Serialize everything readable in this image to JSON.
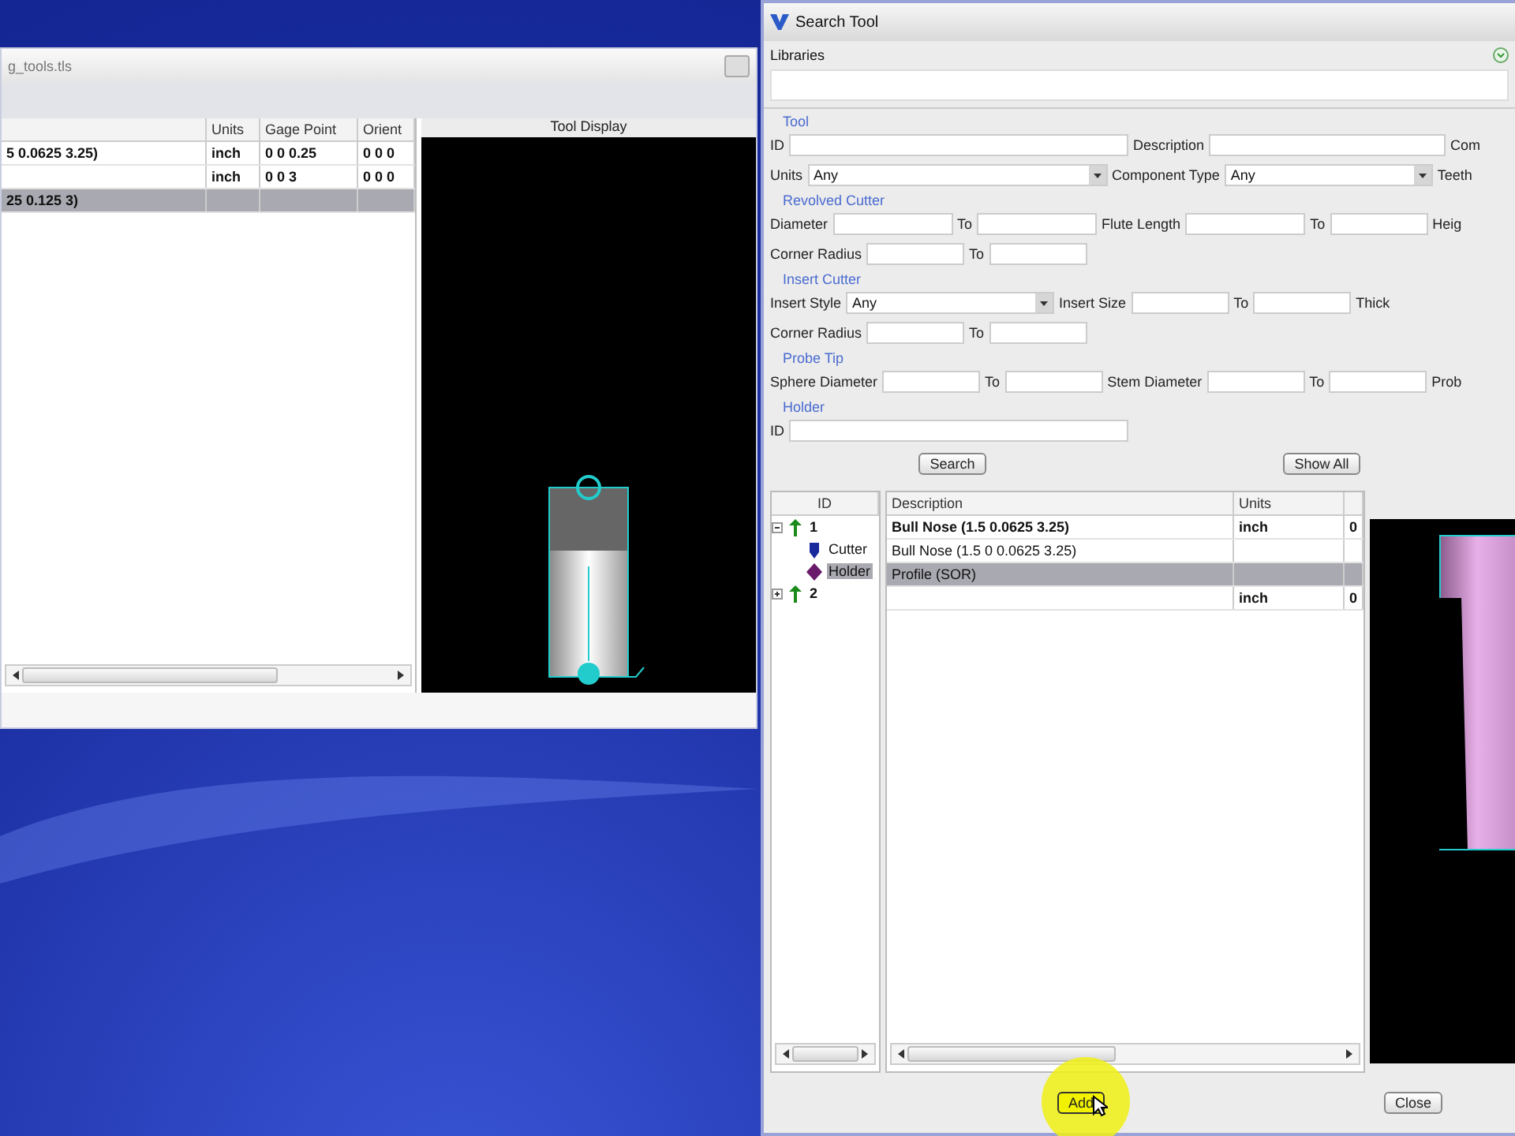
{
  "library_window": {
    "title": "g_tools.tls",
    "table": {
      "columns": [
        "Units",
        "Gage Point",
        "Orient"
      ],
      "rows": [
        {
          "description": "5 0.0625 3.25)",
          "units": "inch",
          "gage_point": "0 0 0.25",
          "orient": "0 0 0",
          "selected": false
        },
        {
          "units": "inch",
          "gage_point": "0 0 3",
          "orient": "0 0 0",
          "selected": false
        },
        {
          "description": "25 0.125 3)",
          "selected": true
        }
      ]
    },
    "tool_display": {
      "title": "Tool Display"
    }
  },
  "search_tool": {
    "title": "Search Tool",
    "libraries": {
      "label": "Libraries",
      "expanded": false
    },
    "groups": [
      {
        "title": "Tool",
        "rows": [
          [
            {
              "kind": "label",
              "text": "ID"
            },
            {
              "kind": "long-field"
            },
            {
              "kind": "label",
              "text": "Description"
            },
            {
              "kind": "medium-field"
            },
            {
              "kind": "label",
              "text": "Com"
            }
          ],
          [
            {
              "kind": "label",
              "text": "Units"
            },
            {
              "kind": "long-select",
              "value": "Any"
            },
            {
              "kind": "label",
              "text": "Component Type"
            },
            {
              "kind": "select",
              "value": "Any"
            },
            {
              "kind": "label",
              "text": "Teeth"
            }
          ]
        ]
      },
      {
        "title": "Revolved Cutter",
        "rows": [
          [
            {
              "kind": "label",
              "text": "Diameter"
            },
            {
              "kind": "field"
            },
            {
              "kind": "label",
              "text": "To"
            },
            {
              "kind": "field"
            },
            {
              "kind": "label",
              "text": "Flute Length"
            },
            {
              "kind": "field"
            },
            {
              "kind": "label",
              "text": "To"
            },
            {
              "kind": "short-field"
            },
            {
              "kind": "label",
              "text": "Heig"
            }
          ],
          [
            {
              "kind": "label",
              "text": "Corner Radius"
            },
            {
              "kind": "short-field"
            },
            {
              "kind": "label",
              "text": "To"
            },
            {
              "kind": "short-field"
            }
          ]
        ]
      },
      {
        "title": "Insert Cutter",
        "rows": [
          [
            {
              "kind": "label",
              "text": "Insert Style"
            },
            {
              "kind": "select",
              "value": "Any"
            },
            {
              "kind": "label",
              "text": "Insert Size"
            },
            {
              "kind": "short-field"
            },
            {
              "kind": "label",
              "text": "To"
            },
            {
              "kind": "short-field"
            },
            {
              "kind": "label",
              "text": "Thick"
            }
          ],
          [
            {
              "kind": "label",
              "text": "Corner Radius"
            },
            {
              "kind": "short-field"
            },
            {
              "kind": "label",
              "text": "To"
            },
            {
              "kind": "short-field"
            }
          ]
        ]
      },
      {
        "title": "Probe Tip",
        "rows": [
          [
            {
              "kind": "label",
              "text": "Sphere Diameter"
            },
            {
              "kind": "short-field"
            },
            {
              "kind": "label",
              "text": "To"
            },
            {
              "kind": "short-field"
            },
            {
              "kind": "label",
              "text": "Stem Diameter"
            },
            {
              "kind": "short-field"
            },
            {
              "kind": "label",
              "text": "To"
            },
            {
              "kind": "short-field"
            },
            {
              "kind": "label",
              "text": "Prob"
            }
          ]
        ]
      },
      {
        "title": "Holder",
        "rows": [
          [
            {
              "kind": "label",
              "text": "ID"
            },
            {
              "kind": "long-field"
            }
          ]
        ]
      }
    ],
    "form_buttons": [
      "Search",
      "Show All"
    ],
    "tree": {
      "column": "ID",
      "items": [
        {
          "label": "1",
          "kind": "tool",
          "expanded": true,
          "selected": false,
          "children": [
            {
              "label": "Cutter",
              "kind": "cutter",
              "selected": false
            },
            {
              "label": "Holder",
              "kind": "holder",
              "selected": true
            }
          ]
        },
        {
          "label": "2",
          "kind": "tool",
          "expanded": false,
          "selected": false
        }
      ]
    },
    "results": {
      "columns": [
        "Description",
        "Units"
      ],
      "rows": [
        {
          "description": "Bull Nose (1.5 0.0625 3.25)",
          "units": "inch",
          "column_3": "0",
          "bold": true,
          "selected": false
        },
        {
          "description": "Bull Nose (1.5 0 0.0625 3.25)",
          "bold": false,
          "selected": false
        },
        {
          "description": "Profile (SOR)",
          "bold": false,
          "selected": true
        },
        {
          "units": "inch",
          "column_3": "0",
          "bold": true,
          "selected": false
        }
      ]
    },
    "buttons": [
      {
        "label": "Add",
        "highlighted": true
      },
      {
        "label": "Close",
        "highlighted": false
      }
    ]
  }
}
